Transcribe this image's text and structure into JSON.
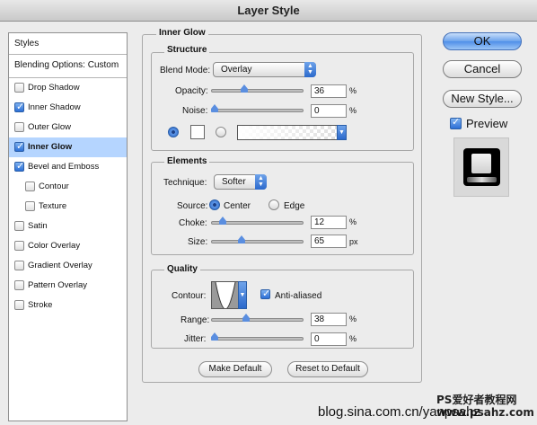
{
  "window": {
    "title": "Layer Style"
  },
  "styles_list": {
    "header": "Styles",
    "blending": "Blending Options: Custom",
    "items": [
      {
        "label": "Drop Shadow",
        "checked": false
      },
      {
        "label": "Inner Shadow",
        "checked": true
      },
      {
        "label": "Outer Glow",
        "checked": false
      },
      {
        "label": "Inner Glow",
        "checked": true,
        "selected": true
      },
      {
        "label": "Bevel and Emboss",
        "checked": true
      },
      {
        "label": "Contour",
        "checked": false
      },
      {
        "label": "Texture",
        "checked": false
      },
      {
        "label": "Satin",
        "checked": false
      },
      {
        "label": "Color Overlay",
        "checked": false
      },
      {
        "label": "Gradient Overlay",
        "checked": false
      },
      {
        "label": "Pattern Overlay",
        "checked": false
      },
      {
        "label": "Stroke",
        "checked": false
      }
    ]
  },
  "inner_glow": {
    "title": "Inner Glow",
    "structure": {
      "title": "Structure",
      "blend_mode_label": "Blend Mode:",
      "blend_mode": "Overlay",
      "opacity_label": "Opacity:",
      "opacity": "36",
      "opacity_unit": "%",
      "noise_label": "Noise:",
      "noise": "0",
      "noise_unit": "%",
      "color_mode": "solid"
    },
    "elements": {
      "title": "Elements",
      "technique_label": "Technique:",
      "technique": "Softer",
      "source_label": "Source:",
      "source_center": "Center",
      "source_edge": "Edge",
      "source_selected": "Center",
      "choke_label": "Choke:",
      "choke": "12",
      "choke_unit": "%",
      "size_label": "Size:",
      "size": "65",
      "size_unit": "px"
    },
    "quality": {
      "title": "Quality",
      "contour_label": "Contour:",
      "anti_aliased_label": "Anti-aliased",
      "anti_aliased": true,
      "range_label": "Range:",
      "range": "38",
      "range_unit": "%",
      "jitter_label": "Jitter:",
      "jitter": "0",
      "jitter_unit": "%"
    },
    "make_default": "Make Default",
    "reset_default": "Reset to Default"
  },
  "buttons": {
    "ok": "OK",
    "cancel": "Cancel",
    "new_style": "New Style...",
    "preview_label": "Preview",
    "preview_checked": true
  },
  "watermark": {
    "url": "blog.sina.com.cn/yanpsahz",
    "site": "PS爱好者教程网 www.psahz.com"
  },
  "colors": {
    "accent": "#3d7ee0",
    "selected_row": "#b5d5ff"
  }
}
